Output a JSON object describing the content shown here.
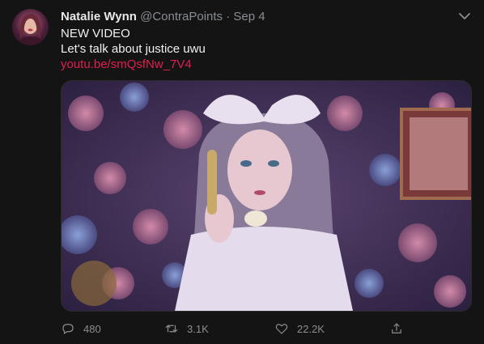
{
  "tweet": {
    "author_name": "Natalie Wynn",
    "author_handle": "@ContraPoints",
    "separator": "·",
    "date": "Sep 4",
    "text_line1": "NEW VIDEO",
    "text_line2": "Let's talk about justice uwu",
    "link": "youtu.be/smQsfNw_7V4"
  },
  "actions": {
    "replies": "480",
    "retweets": "3.1K",
    "likes": "22.2K"
  },
  "icons": {
    "menu": "chevron-down-icon",
    "reply": "reply-icon",
    "retweet": "retweet-icon",
    "like": "heart-icon",
    "share": "share-icon"
  },
  "colors": {
    "background": "#141414",
    "link": "#e01f4f",
    "muted": "#8a8d91"
  }
}
